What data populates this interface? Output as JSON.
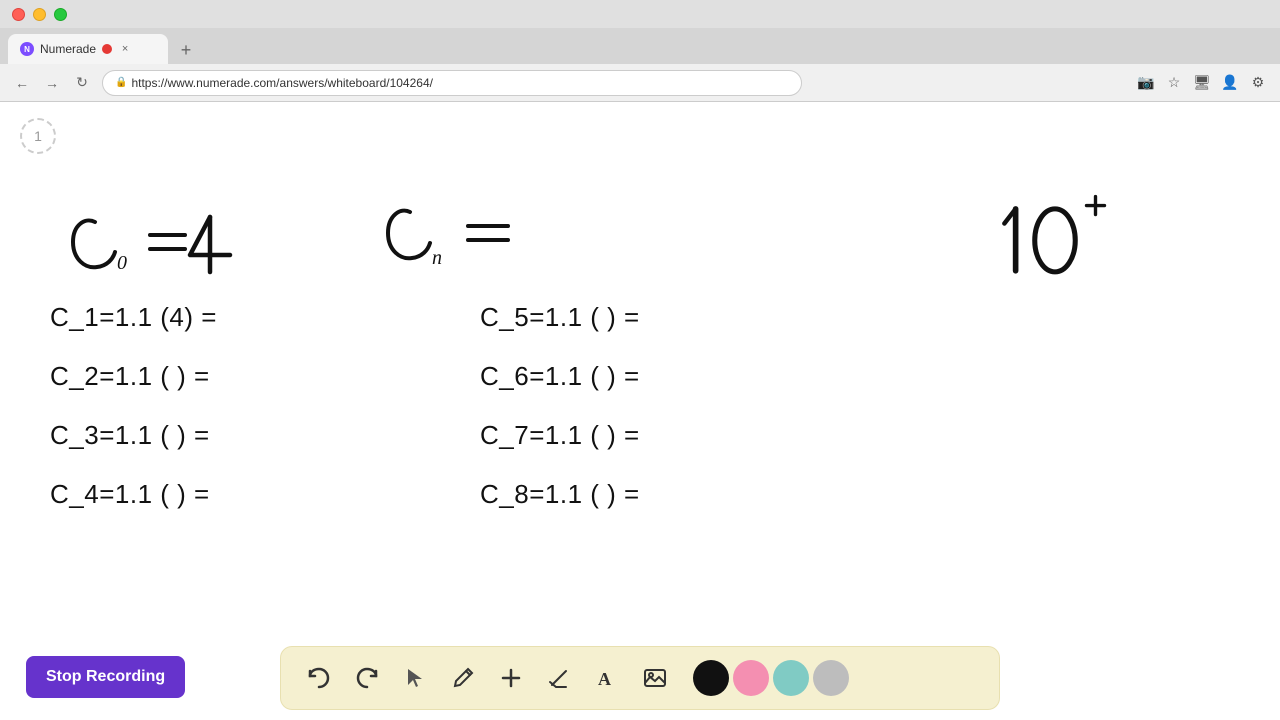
{
  "browser": {
    "traffic_lights": [
      "red",
      "yellow",
      "green"
    ],
    "tab_title": "Numerade",
    "tab_icon": "N",
    "new_tab_label": "+",
    "nav": {
      "back": "←",
      "forward": "→",
      "refresh": "↻"
    },
    "url": "https://www.numerade.com/answers/whiteboard/104264/",
    "addr_icons": [
      "camera",
      "star",
      "monitor",
      "profile",
      "settings"
    ]
  },
  "page": {
    "page_number": "1",
    "handwritten": {
      "c0_eq": "c₀= 4",
      "cn_eq": "cₙ =",
      "ten_plus": "10⁺"
    },
    "equations_left": [
      "C_1=1.1 (4) =",
      "C_2=1.1 ( ) =",
      "C_3=1.1 ( ) =",
      "C_4=1.1 ( ) ="
    ],
    "equations_right": [
      "C_5=1.1 ( ) =",
      "C_6=1.1 ( ) =",
      "C_7=1.1 ( ) =",
      "C_8=1.1 ( ) ="
    ]
  },
  "toolbar": {
    "tools": [
      {
        "name": "undo",
        "icon": "↩",
        "label": "Undo"
      },
      {
        "name": "redo",
        "icon": "↪",
        "label": "Redo"
      },
      {
        "name": "select",
        "icon": "▷",
        "label": "Select"
      },
      {
        "name": "pencil",
        "icon": "✏",
        "label": "Pencil"
      },
      {
        "name": "add",
        "icon": "+",
        "label": "Add"
      },
      {
        "name": "eraser",
        "icon": "◱",
        "label": "Eraser"
      },
      {
        "name": "text",
        "icon": "A",
        "label": "Text"
      },
      {
        "name": "image",
        "icon": "▦",
        "label": "Image"
      }
    ],
    "colors": [
      {
        "name": "black",
        "hex": "#111111"
      },
      {
        "name": "pink",
        "hex": "#f48fb1"
      },
      {
        "name": "green",
        "hex": "#80cbc4"
      },
      {
        "name": "gray",
        "hex": "#bdbdbd"
      }
    ]
  },
  "stop_recording": {
    "label": "Stop Recording",
    "bg_color": "#6633cc",
    "text_color": "#ffffff"
  }
}
